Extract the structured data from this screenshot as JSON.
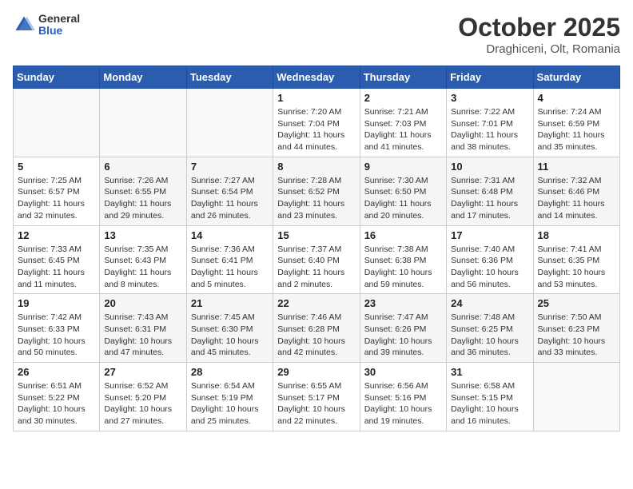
{
  "header": {
    "logo_general": "General",
    "logo_blue": "Blue",
    "month_title": "October 2025",
    "location": "Draghiceni, Olt, Romania"
  },
  "weekdays": [
    "Sunday",
    "Monday",
    "Tuesday",
    "Wednesday",
    "Thursday",
    "Friday",
    "Saturday"
  ],
  "weeks": [
    [
      {
        "day": "",
        "info": ""
      },
      {
        "day": "",
        "info": ""
      },
      {
        "day": "",
        "info": ""
      },
      {
        "day": "1",
        "info": "Sunrise: 7:20 AM\nSunset: 7:04 PM\nDaylight: 11 hours and 44 minutes."
      },
      {
        "day": "2",
        "info": "Sunrise: 7:21 AM\nSunset: 7:03 PM\nDaylight: 11 hours and 41 minutes."
      },
      {
        "day": "3",
        "info": "Sunrise: 7:22 AM\nSunset: 7:01 PM\nDaylight: 11 hours and 38 minutes."
      },
      {
        "day": "4",
        "info": "Sunrise: 7:24 AM\nSunset: 6:59 PM\nDaylight: 11 hours and 35 minutes."
      }
    ],
    [
      {
        "day": "5",
        "info": "Sunrise: 7:25 AM\nSunset: 6:57 PM\nDaylight: 11 hours and 32 minutes."
      },
      {
        "day": "6",
        "info": "Sunrise: 7:26 AM\nSunset: 6:55 PM\nDaylight: 11 hours and 29 minutes."
      },
      {
        "day": "7",
        "info": "Sunrise: 7:27 AM\nSunset: 6:54 PM\nDaylight: 11 hours and 26 minutes."
      },
      {
        "day": "8",
        "info": "Sunrise: 7:28 AM\nSunset: 6:52 PM\nDaylight: 11 hours and 23 minutes."
      },
      {
        "day": "9",
        "info": "Sunrise: 7:30 AM\nSunset: 6:50 PM\nDaylight: 11 hours and 20 minutes."
      },
      {
        "day": "10",
        "info": "Sunrise: 7:31 AM\nSunset: 6:48 PM\nDaylight: 11 hours and 17 minutes."
      },
      {
        "day": "11",
        "info": "Sunrise: 7:32 AM\nSunset: 6:46 PM\nDaylight: 11 hours and 14 minutes."
      }
    ],
    [
      {
        "day": "12",
        "info": "Sunrise: 7:33 AM\nSunset: 6:45 PM\nDaylight: 11 hours and 11 minutes."
      },
      {
        "day": "13",
        "info": "Sunrise: 7:35 AM\nSunset: 6:43 PM\nDaylight: 11 hours and 8 minutes."
      },
      {
        "day": "14",
        "info": "Sunrise: 7:36 AM\nSunset: 6:41 PM\nDaylight: 11 hours and 5 minutes."
      },
      {
        "day": "15",
        "info": "Sunrise: 7:37 AM\nSunset: 6:40 PM\nDaylight: 11 hours and 2 minutes."
      },
      {
        "day": "16",
        "info": "Sunrise: 7:38 AM\nSunset: 6:38 PM\nDaylight: 10 hours and 59 minutes."
      },
      {
        "day": "17",
        "info": "Sunrise: 7:40 AM\nSunset: 6:36 PM\nDaylight: 10 hours and 56 minutes."
      },
      {
        "day": "18",
        "info": "Sunrise: 7:41 AM\nSunset: 6:35 PM\nDaylight: 10 hours and 53 minutes."
      }
    ],
    [
      {
        "day": "19",
        "info": "Sunrise: 7:42 AM\nSunset: 6:33 PM\nDaylight: 10 hours and 50 minutes."
      },
      {
        "day": "20",
        "info": "Sunrise: 7:43 AM\nSunset: 6:31 PM\nDaylight: 10 hours and 47 minutes."
      },
      {
        "day": "21",
        "info": "Sunrise: 7:45 AM\nSunset: 6:30 PM\nDaylight: 10 hours and 45 minutes."
      },
      {
        "day": "22",
        "info": "Sunrise: 7:46 AM\nSunset: 6:28 PM\nDaylight: 10 hours and 42 minutes."
      },
      {
        "day": "23",
        "info": "Sunrise: 7:47 AM\nSunset: 6:26 PM\nDaylight: 10 hours and 39 minutes."
      },
      {
        "day": "24",
        "info": "Sunrise: 7:48 AM\nSunset: 6:25 PM\nDaylight: 10 hours and 36 minutes."
      },
      {
        "day": "25",
        "info": "Sunrise: 7:50 AM\nSunset: 6:23 PM\nDaylight: 10 hours and 33 minutes."
      }
    ],
    [
      {
        "day": "26",
        "info": "Sunrise: 6:51 AM\nSunset: 5:22 PM\nDaylight: 10 hours and 30 minutes."
      },
      {
        "day": "27",
        "info": "Sunrise: 6:52 AM\nSunset: 5:20 PM\nDaylight: 10 hours and 27 minutes."
      },
      {
        "day": "28",
        "info": "Sunrise: 6:54 AM\nSunset: 5:19 PM\nDaylight: 10 hours and 25 minutes."
      },
      {
        "day": "29",
        "info": "Sunrise: 6:55 AM\nSunset: 5:17 PM\nDaylight: 10 hours and 22 minutes."
      },
      {
        "day": "30",
        "info": "Sunrise: 6:56 AM\nSunset: 5:16 PM\nDaylight: 10 hours and 19 minutes."
      },
      {
        "day": "31",
        "info": "Sunrise: 6:58 AM\nSunset: 5:15 PM\nDaylight: 10 hours and 16 minutes."
      },
      {
        "day": "",
        "info": ""
      }
    ]
  ]
}
